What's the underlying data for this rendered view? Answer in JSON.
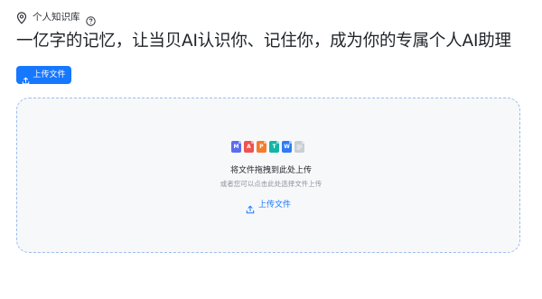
{
  "header": {
    "title": "个人知识库",
    "pin_icon": "location-pin-icon",
    "help_icon": "help-circle-icon"
  },
  "headline": "一亿字的记忆，让当贝AI认识你、记住你，成为你的专属个人AI助理",
  "toolbar": {
    "upload_label": "上传文件",
    "upload_icon": "upload-icon"
  },
  "dropzone": {
    "file_types": [
      {
        "letter": "M",
        "color": "#5b6cf0"
      },
      {
        "letter": "A",
        "color": "#ef5350"
      },
      {
        "letter": "P",
        "color": "#f57c2b"
      },
      {
        "letter": "T",
        "color": "#13b5a5"
      },
      {
        "letter": "W",
        "color": "#2f7bf5"
      },
      {
        "letter": "",
        "color": "#c9cdd4"
      }
    ],
    "drag_text": "将文件拖拽到此处上传",
    "sub_text": "或者您可以点击此处选择文件上传",
    "link_label": "上传文件"
  },
  "colors": {
    "accent": "#1677ff",
    "dropzone_border": "#9dbdf0",
    "dropzone_bg": "#f7f8fa"
  }
}
